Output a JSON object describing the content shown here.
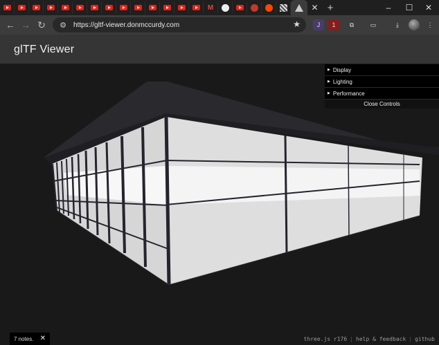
{
  "browser": {
    "tabs": [
      "youtube",
      "youtube",
      "youtube",
      "youtube",
      "youtube",
      "youtube",
      "youtube",
      "youtube",
      "youtube",
      "youtube",
      "youtube",
      "youtube",
      "youtube",
      "youtube",
      "youtube",
      "gmail",
      "github",
      "youtube",
      "red",
      "reddit",
      "grid",
      "triangle"
    ],
    "new_tab_symbol": "+",
    "address": "https://gltf-viewer.donmccurdy.com",
    "window_controls": {
      "minimize": "–",
      "maximize": "☐",
      "close": "✕"
    }
  },
  "page": {
    "title": "glTF Viewer"
  },
  "controls": {
    "folders": [
      "Display",
      "Lighting",
      "Performance"
    ],
    "close_label": "Close Controls"
  },
  "notes": {
    "label": "7 notes.",
    "close": "✕"
  },
  "footer": {
    "version": "three.js r176",
    "feedback": "help & feedback",
    "github": "github"
  },
  "colors": {
    "background": "#191919",
    "header": "#353535",
    "roof": "#2a2a2e",
    "mullion": "#25242e",
    "glass": "#e4e4e4"
  }
}
